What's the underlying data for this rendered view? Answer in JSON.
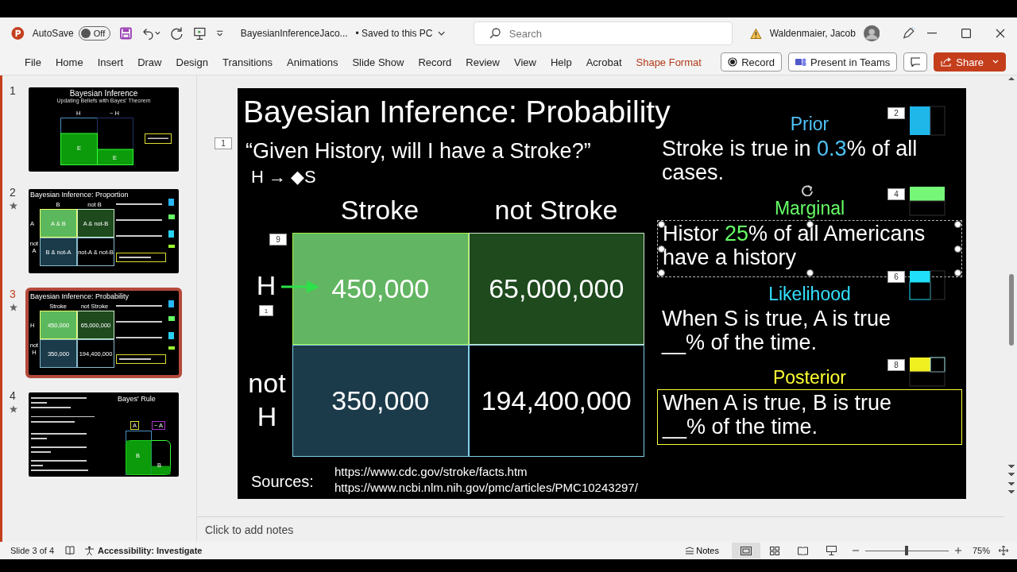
{
  "titlebar": {
    "app_name": "AutoSave",
    "autosave": {
      "on": false,
      "label": "Off"
    },
    "file_name": "BayesianInferenceJaco...",
    "save_status": "• Saved to this PC",
    "search": {
      "placeholder": "Search"
    },
    "user_name": "Waldenmaier, Jacob"
  },
  "ribbon": {
    "tabs": [
      {
        "label": "File",
        "contextual": false
      },
      {
        "label": "Home",
        "contextual": false
      },
      {
        "label": "Insert",
        "contextual": false
      },
      {
        "label": "Draw",
        "contextual": false
      },
      {
        "label": "Design",
        "contextual": false
      },
      {
        "label": "Transitions",
        "contextual": false
      },
      {
        "label": "Animations",
        "contextual": false
      },
      {
        "label": "Slide Show",
        "contextual": false
      },
      {
        "label": "Record",
        "contextual": false
      },
      {
        "label": "Review",
        "contextual": false
      },
      {
        "label": "View",
        "contextual": false
      },
      {
        "label": "Help",
        "contextual": false
      },
      {
        "label": "Acrobat",
        "contextual": false
      },
      {
        "label": "Shape Format",
        "contextual": true
      }
    ],
    "actions": [
      {
        "kind": "record",
        "label": "Record"
      },
      {
        "kind": "teams",
        "label": "Present in Teams"
      },
      {
        "kind": "comment"
      },
      {
        "kind": "share",
        "label": "Share"
      }
    ]
  },
  "thumbnails": [
    {
      "number": "1",
      "starred": false,
      "selected": false,
      "kind": "bars",
      "title": "Bayesian Inference",
      "subtitle": "Updating Beliefs with Bayes' Theorem",
      "labels": [
        "H",
        "~ H",
        "E",
        "E"
      ]
    },
    {
      "number": "2",
      "starred": true,
      "selected": false,
      "kind": "grid",
      "title": "Bayesian Inference: Proportion",
      "columns": [
        "B",
        "not B"
      ],
      "rows": [
        "A",
        "not A"
      ],
      "cells": [
        "A & B",
        "A & not-B",
        "B & not-A",
        "not-A & not-B"
      ]
    },
    {
      "number": "3",
      "starred": true,
      "selected": true,
      "kind": "grid",
      "title": "Bayesian Inference: Probability",
      "columns": [
        "Stroke",
        "not Stroke"
      ],
      "rows": [
        "H",
        "not H"
      ],
      "cells": [
        "450,000",
        "65,000,000",
        "350,000",
        "194,400,000"
      ]
    },
    {
      "number": "4",
      "starred": true,
      "selected": false,
      "kind": "rule",
      "title": "Bayes' Rule",
      "labels": [
        "A",
        "~ A",
        "B",
        "B"
      ]
    }
  ],
  "slide": {
    "title": "Bayesian Inference: Probability",
    "question": "“Given History, will I have a Stroke?”",
    "implication": "H → ◆S",
    "columns": [
      "Stroke",
      "not Stroke"
    ],
    "rows": [
      "H",
      "not H"
    ],
    "cells": [
      {
        "value": "450,000",
        "color": "#62b562"
      },
      {
        "value": "65,000,000",
        "color": "#1e4a1e"
      },
      {
        "value": "350,000",
        "color": "#1b3a4a"
      },
      {
        "value": "194,400,000",
        "color": "#000000"
      }
    ],
    "sections": [
      {
        "heading": "Prior",
        "color": "#4fc3f7",
        "tag": "2",
        "boxed": false,
        "selected": false,
        "parts": [
          {
            "text": "Stroke is true in ",
            "accent": false
          },
          {
            "text": "0.3",
            "accent": true
          },
          {
            "text": "% of all cases.",
            "accent": false
          }
        ]
      },
      {
        "heading": "Marginal",
        "color": "#66ff66",
        "tag": "4",
        "boxed": false,
        "selected": true,
        "parts": [
          {
            "text": "Histor ",
            "accent": false
          },
          {
            "text": "25",
            "accent": true
          },
          {
            "text": "% of all Americans have a history",
            "accent": false
          }
        ]
      },
      {
        "heading": "Likelihood",
        "color": "#33e0ff",
        "tag": "6",
        "boxed": false,
        "selected": false,
        "parts": [
          {
            "text": "When S is true, A is true __% of the time.",
            "accent": false
          }
        ]
      },
      {
        "heading": "Posterior",
        "color": "#ffff33",
        "tag": "8",
        "boxed": true,
        "selected": false,
        "parts": [
          {
            "text": "When A is true, B is true __% of the time.",
            "accent": false
          }
        ]
      }
    ],
    "tags": [
      "1",
      "9",
      "1"
    ],
    "sources_label": "Sources:",
    "sources": [
      "https://www.cdc.gov/stroke/facts.htm",
      "https://www.ncbi.nlm.nih.gov/pmc/articles/PMC10243297/"
    ]
  },
  "notes": {
    "placeholder": "Click to add notes"
  },
  "status_bar": {
    "slide_info": "Slide 3 of 4",
    "accessibility": "Accessibility: Investigate",
    "notes": "Notes",
    "zoom": {
      "level": 0.5,
      "label": "75%"
    }
  }
}
